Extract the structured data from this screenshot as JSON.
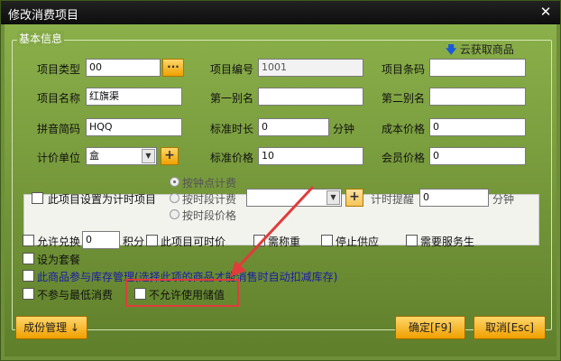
{
  "window": {
    "title": "修改消费项目"
  },
  "group": {
    "title": "基本信息"
  },
  "cloud": {
    "label": "云获取商品"
  },
  "fields": {
    "type_label": "项目类型",
    "type_value": "00",
    "code_label": "项目编号",
    "code_value": "1001",
    "barcode_label": "项目条码",
    "barcode_value": "",
    "name_label": "项目名称",
    "name_value": "红旗渠",
    "alias1_label": "第一别名",
    "alias1_value": "",
    "alias2_label": "第二别名",
    "alias2_value": "",
    "pinyin_label": "拼音简码",
    "pinyin_value": "HQQ",
    "duration_label": "标准时长",
    "duration_value": "0",
    "duration_unit": "分钟",
    "cost_label": "成本价格",
    "cost_value": "0",
    "unit_label": "计价单位",
    "unit_value": "盒",
    "price_label": "标准价格",
    "price_value": "10",
    "member_label": "会员价格",
    "member_value": "0"
  },
  "timing": {
    "checkbox_label": "此项目设置为计时项目",
    "radio_1": "按钟点计费",
    "radio_2": "按时段计费",
    "radio_3": "按时段价格",
    "reminder_label": "计时提醒",
    "reminder_value": "0",
    "reminder_unit": "分钟"
  },
  "options": {
    "exchange": "允许兑换",
    "exchange_value": "0",
    "points": "积分",
    "timeable": "此项目可时价",
    "weigh": "需称重",
    "stop_supply": "停止供应",
    "need_service": "需要服务生",
    "set_meal": "设为套餐",
    "inventory": "此商品参与库存管理(选择此项的商品才能消售时自动扣减库存)",
    "no_min": "不参与最低消费",
    "no_stored": "不允许使用储值"
  },
  "buttons": {
    "cost_mgmt": "成份管理 ↓",
    "ok": "确定[F9]",
    "cancel": "取消[Esc]"
  },
  "colors": {
    "accent": "#f0a000",
    "annotation": "#e23b3b"
  }
}
